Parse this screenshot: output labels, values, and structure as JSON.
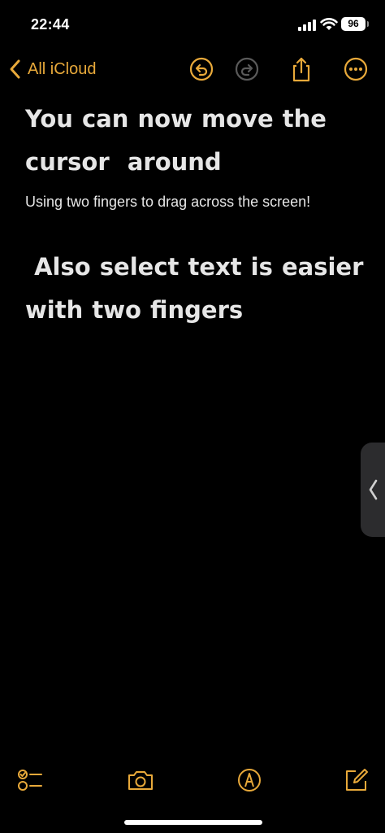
{
  "status": {
    "time": "22:44",
    "battery": "96"
  },
  "nav": {
    "back_label": "All iCloud"
  },
  "note": {
    "heading_1": "You can now move the cursor  around",
    "body": "Using two fingers to drag across the screen!",
    "heading_2": " Also select text is easier with two fingers"
  },
  "colors": {
    "accent": "#e8a93a",
    "disabled": "#5a5a5a",
    "background": "#000000",
    "text": "#e6e6e6"
  },
  "icons": {
    "back": "chevron-left-icon",
    "undo": "undo-icon",
    "redo": "redo-icon",
    "share": "share-icon",
    "more": "more-icon",
    "side": "chevron-left-icon",
    "checklist": "checklist-icon",
    "camera": "camera-icon",
    "markup": "markup-icon",
    "compose": "compose-icon"
  }
}
